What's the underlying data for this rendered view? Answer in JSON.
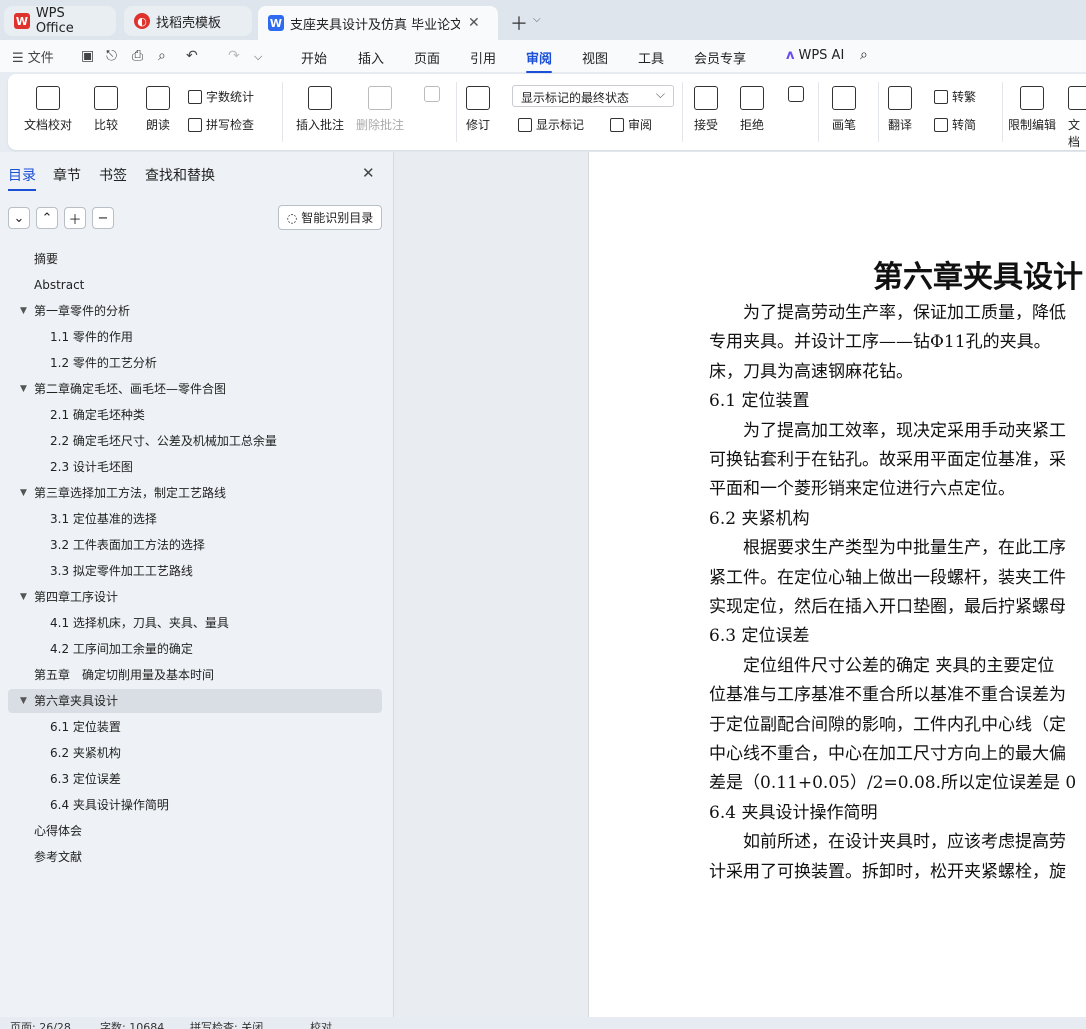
{
  "tabs": {
    "wps_office": "WPS Office",
    "template": "找稻壳模板",
    "doc": "支座夹具设计及仿真 毕业论文"
  },
  "menu": {
    "file": "文件",
    "items": [
      "开始",
      "插入",
      "页面",
      "引用",
      "审阅",
      "视图",
      "工具",
      "会员专享"
    ],
    "active": "审阅",
    "wps_ai": "WPS AI"
  },
  "ribbon": {
    "doc_proof": "文档校对",
    "compare": "比较",
    "read": "朗读",
    "word_count": "字数统计",
    "spell_check": "拼写检查",
    "insert_comment": "插入批注",
    "delete_comment": "删除批注",
    "revise": "修订",
    "display_dropdown": "显示标记的最终状态",
    "show_markup": "显示标记",
    "review": "审阅",
    "accept": "接受",
    "reject": "拒绝",
    "pen": "画笔",
    "translate": "翻译",
    "to_traditional": "转繁",
    "to_simplified": "转简",
    "restrict_edit": "限制编辑",
    "doc_cut": "文档"
  },
  "nav": {
    "tabs": [
      "目录",
      "章节",
      "书签",
      "查找和替换"
    ],
    "smart_toc": "智能识别目录",
    "toc": [
      {
        "text": "摘要",
        "level": 1,
        "arrow": false
      },
      {
        "text": "Abstract",
        "level": 1,
        "arrow": false
      },
      {
        "text": "第一章零件的分析",
        "level": 1,
        "arrow": true
      },
      {
        "text": "1.1 零件的作用",
        "level": 2,
        "arrow": false
      },
      {
        "text": "1.2 零件的工艺分析",
        "level": 2,
        "arrow": false
      },
      {
        "text": "第二章确定毛坯、画毛坯—零件合图",
        "level": 1,
        "arrow": true
      },
      {
        "text": "2.1 确定毛坯种类",
        "level": 2,
        "arrow": false
      },
      {
        "text": "2.2 确定毛坯尺寸、公差及机械加工总余量",
        "level": 2,
        "arrow": false
      },
      {
        "text": "2.3 设计毛坯图",
        "level": 2,
        "arrow": false
      },
      {
        "text": "第三章选择加工方法，制定工艺路线",
        "level": 1,
        "arrow": true
      },
      {
        "text": "3.1 定位基准的选择",
        "level": 2,
        "arrow": false
      },
      {
        "text": "3.2 工件表面加工方法的选择",
        "level": 2,
        "arrow": false
      },
      {
        "text": "3.3 拟定零件加工工艺路线",
        "level": 2,
        "arrow": false
      },
      {
        "text": "第四章工序设计",
        "level": 1,
        "arrow": true
      },
      {
        "text": "4.1 选择机床，刀具、夹具、量具",
        "level": 2,
        "arrow": false
      },
      {
        "text": "4.2 工序间加工余量的确定",
        "level": 2,
        "arrow": false
      },
      {
        "text": "第五章　确定切削用量及基本时间",
        "level": 1,
        "arrow": false
      },
      {
        "text": "第六章夹具设计",
        "level": 1,
        "arrow": true
      },
      {
        "text": "6.1 定位装置",
        "level": 2,
        "arrow": false
      },
      {
        "text": "6.2 夹紧机构",
        "level": 2,
        "arrow": false
      },
      {
        "text": "6.3 定位误差",
        "level": 2,
        "arrow": false
      },
      {
        "text": "6.4 夹具设计操作简明",
        "level": 2,
        "arrow": false
      },
      {
        "text": "心得体会",
        "level": 1,
        "arrow": false
      },
      {
        "text": "参考文献",
        "level": 1,
        "arrow": false
      }
    ]
  },
  "document": {
    "title": "第六章夹具设计",
    "lines": [
      "　　为了提高劳动生产率，保证加工质量，降低",
      "专用夹具。并设计工序——钻Φ11孔的夹具。",
      "床，刀具为高速钢麻花钻。",
      "6.1 定位装置",
      "　　为了提高加工效率，现决定采用手动夹紧工",
      "可换钻套利于在钻孔。故采用平面定位基准，采",
      "平面和一个菱形销来定位进行六点定位。",
      "6.2 夹紧机构",
      "　　根据要求生产类型为中批量生产，在此工序",
      "紧工件。在定位心轴上做出一段螺杆，装夹工件",
      "实现定位，然后在插入开口垫圈，最后拧紧螺母",
      "6.3 定位误差",
      "　　定位组件尺寸公差的确定 夹具的主要定位",
      "位基准与工序基准不重合所以基准不重合误差为",
      "于定位副配合间隙的影响，工件内孔中心线（定",
      "中心线不重合，中心在加工尺寸方向上的最大偏",
      "差是（0.11+0.05）/2=0.08.所以定位误差是 0",
      "6.4 夹具设计操作简明",
      "　　如前所述，在设计夹具时，应该考虑提高劳",
      "计采用了可换装置。拆卸时，松开夹紧螺栓，旋"
    ]
  },
  "status": {
    "page": "页面: 26/28",
    "words": "字数: 10684",
    "spell": "拼写检查: 关闭",
    "proof": "校对"
  }
}
